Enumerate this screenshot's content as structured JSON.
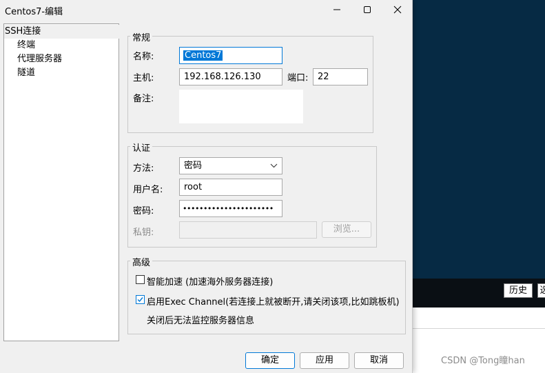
{
  "window": {
    "title": "Centos7-编辑"
  },
  "tree": {
    "items": [
      "SSH连接",
      "终端",
      "代理服务器",
      "隧道"
    ]
  },
  "general": {
    "title": "常规",
    "name_label": "名称:",
    "name_value": "Centos7",
    "host_label": "主机:",
    "host_value": "192.168.126.130",
    "port_label": "端口:",
    "port_value": "22",
    "note_label": "备注:",
    "note_value": ""
  },
  "auth": {
    "title": "认证",
    "method_label": "方法:",
    "method_value": "密码",
    "user_label": "用户名:",
    "user_value": "root",
    "password_label": "密码:",
    "password_value": "••••••••••••••••••••••",
    "key_label": "私钥:",
    "key_value": "",
    "browse_label": "浏览..."
  },
  "advanced": {
    "title": "高级",
    "accel_label": "智能加速 (加速海外服务器连接)",
    "accel_checked": false,
    "exec_label": "启用Exec Channel(若连接上就被断开,请关闭该项,比如跳板机)",
    "exec_checked": true,
    "exec_note": "关闭后无法监控服务器信息"
  },
  "buttons": {
    "ok": "确定",
    "apply": "应用",
    "cancel": "取消"
  },
  "background": {
    "history_label": "历史",
    "partial_label": "选",
    "watermark": "CSDN @Tong瞳han"
  },
  "colors": {
    "accent": "#0078d7",
    "terminal_bg": "#062a44"
  }
}
